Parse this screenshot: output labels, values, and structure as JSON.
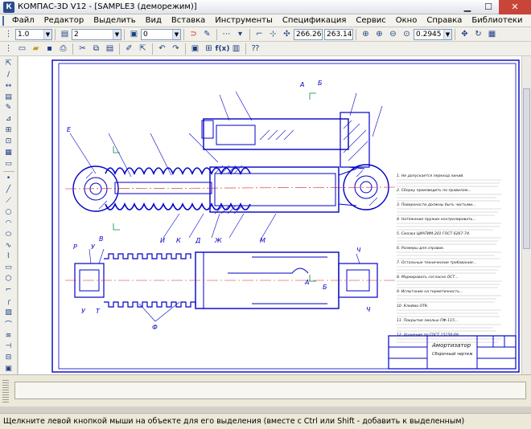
{
  "window": {
    "title": "КОМПАС-3D V12 - [SAMPLE3 (деморежим)]",
    "app_icon_letter": "К",
    "minimize": "▁",
    "maximize": "☐",
    "close": "✕"
  },
  "menu": {
    "items": [
      "Файл",
      "Редактор",
      "Выделить",
      "Вид",
      "Вставка",
      "Инструменты",
      "Спецификация",
      "Сервис",
      "Окно",
      "Справка",
      "Библиотеки"
    ],
    "doc_controls": [
      "_",
      "▫",
      "x"
    ]
  },
  "toolbar1": {
    "line_width": "1.0",
    "layer": "2",
    "style": "0",
    "coord_x": "266.26",
    "coord_y": "263.14",
    "zoom": "0.2945"
  },
  "drawing": {
    "title_block_name": "Амортизатор",
    "title_block_sub": "Сборочный чертеж",
    "notes_heading": "Технические требования",
    "notes": [
      "1. Не допускается переход линий.",
      "2. Сборку производить по правилам...",
      "3. Поверхности должны быть чистыми...",
      "4. Натяжение пружин контролировать...",
      "5. Смазка ЦИАТИМ-201 ГОСТ 6267-74.",
      "6. Размеры для справок.",
      "7. Остальные технические требования...",
      "8. Маркировать согласно ОСТ...",
      "9. Испытание на герметичность...",
      "10. Клеймо ОТК.",
      "11. Покрытие эмалью ПФ-115...",
      "12. Хранение по ГОСТ 15150-69."
    ],
    "section_labels": [
      "А",
      "Б",
      "А",
      "Б"
    ],
    "letters": [
      "Д",
      "Е",
      "Ж",
      "И",
      "К",
      "Л",
      "М",
      "Т",
      "Ф",
      "Ч",
      "У",
      "Р",
      "В"
    ]
  },
  "status": {
    "text": "Щелкните левой кнопкой мыши на объекте для его выделения (вместе с Ctrl или Shift - добавить к выделенным)"
  },
  "colors": {
    "drawing_blue": "#0000c8",
    "axis_red": "#d22020",
    "dim_green": "#008a3a",
    "hatch_blue": "#1818d0"
  }
}
